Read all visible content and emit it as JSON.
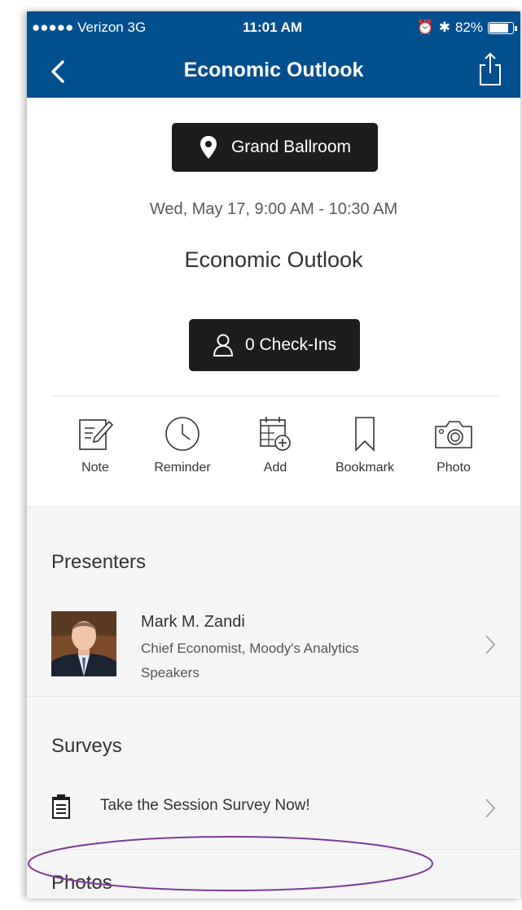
{
  "status_bar": {
    "carrier": "●●●●● Verizon  3G",
    "time": "11:01 AM",
    "battery": "82%"
  },
  "nav": {
    "title": "Economic Outlook",
    "back_icon": "chevron-left-icon",
    "share_icon": "share-icon"
  },
  "session": {
    "location": "Grand Ballroom",
    "datetime": "Wed, May 17, 9:00 AM - 10:30 AM",
    "title": "Economic Outlook",
    "checkins": "0 Check-Ins"
  },
  "actions": [
    {
      "label": "Note",
      "icon": "note-icon"
    },
    {
      "label": "Reminder",
      "icon": "clock-icon"
    },
    {
      "label": "Add",
      "icon": "calendar-add-icon"
    },
    {
      "label": "Bookmark",
      "icon": "bookmark-icon"
    },
    {
      "label": "Photo",
      "icon": "camera-icon"
    }
  ],
  "presenters": {
    "heading": "Presenters",
    "items": [
      {
        "name": "Mark M. Zandi",
        "role": "Chief Economist, Moody's Analytics",
        "type": "Speakers"
      }
    ]
  },
  "surveys": {
    "heading": "Surveys",
    "items": [
      {
        "label": "Take the Session Survey Now!",
        "icon": "clipboard-icon"
      }
    ]
  },
  "photos": {
    "heading": "Photos"
  },
  "colors": {
    "brand": "#024f8e",
    "button_dark": "#1d1d1d",
    "annotation": "#7b3a96"
  }
}
